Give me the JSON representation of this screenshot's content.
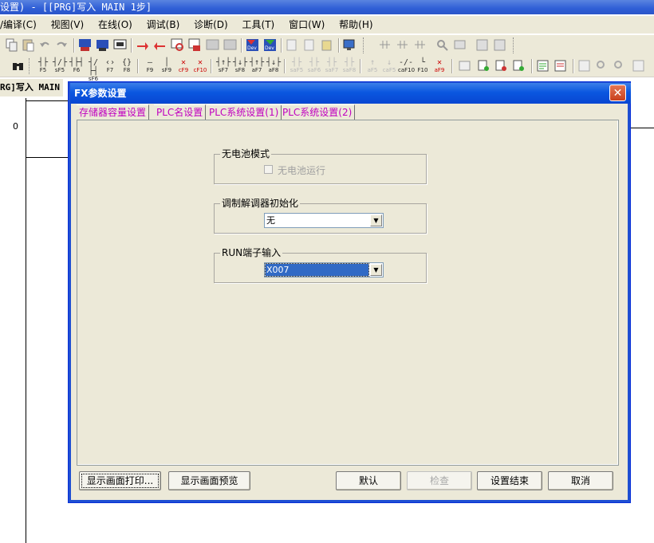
{
  "app": {
    "title": "设置) - [[PRG]写入 MAIN 1步]",
    "menu": [
      "/编译(C)",
      "视图(V)",
      "在线(O)",
      "调试(B)",
      "诊断(D)",
      "工具(T)",
      "窗口(W)",
      "帮助(H)"
    ]
  },
  "toolbar2": {
    "keys": [
      {
        "top": "┤├",
        "label": "F5"
      },
      {
        "top": "┤/├",
        "label": "sF5"
      },
      {
        "top": "┤├┤",
        "label": "F6"
      },
      {
        "top": "┤/├┤",
        "label": "sF6"
      },
      {
        "top": "‹›",
        "label": "F7"
      },
      {
        "top": "{}",
        "label": "F8"
      },
      {
        "top": "—",
        "label": "F9"
      },
      {
        "top": "│",
        "label": "sF9"
      },
      {
        "top": "✕",
        "label": "cF9"
      },
      {
        "top": "✕",
        "label": "cF10"
      },
      {
        "top": "┤↑├",
        "label": "sF7"
      },
      {
        "top": "┤↓├",
        "label": "sF8"
      },
      {
        "top": "┤↑├",
        "label": "aF7"
      },
      {
        "top": "┤↓├",
        "label": "aF8"
      },
      {
        "top": "┤├",
        "label": "saF5",
        "dim": true
      },
      {
        "top": "┤├",
        "label": "saF6",
        "dim": true
      },
      {
        "top": "┤├",
        "label": "saF7",
        "dim": true
      },
      {
        "top": "┤├",
        "label": "saF8",
        "dim": true
      },
      {
        "top": "↑",
        "label": "aF5",
        "dim": true
      },
      {
        "top": "↓",
        "label": "caF5",
        "dim": true
      },
      {
        "top": "-/-",
        "label": "caF10"
      },
      {
        "top": "└",
        "label": "F10"
      },
      {
        "top": "✕",
        "label": "aF9"
      }
    ]
  },
  "editor": {
    "tab_label": "RG]写入 MAIN",
    "step_number": "0"
  },
  "dialog": {
    "title": "FX参数设置",
    "close_symbol": "✕",
    "tabs": [
      "存储器容量设置",
      "PLC名设置",
      "PLC系统设置(1)",
      "PLC系统设置(2)"
    ],
    "active_tab_index": 2,
    "battery_group": {
      "label": "无电池模式",
      "checkbox_label": "无电池运行",
      "checked": false,
      "enabled": false
    },
    "modem_group": {
      "label": "调制解调器初始化",
      "value": "无"
    },
    "run_group": {
      "label": "RUN端子输入",
      "value": "X007"
    },
    "buttons": {
      "print": "显示画面打印...",
      "preview": "显示画面预览",
      "default": "默认",
      "check": "检查",
      "finish": "设置结束",
      "cancel": "取消"
    }
  },
  "colors": {
    "title_bar": "#0b57e0",
    "tab_text": "#c000c0",
    "selection": "#316ac5",
    "dialog_bg": "#ece9d8"
  }
}
